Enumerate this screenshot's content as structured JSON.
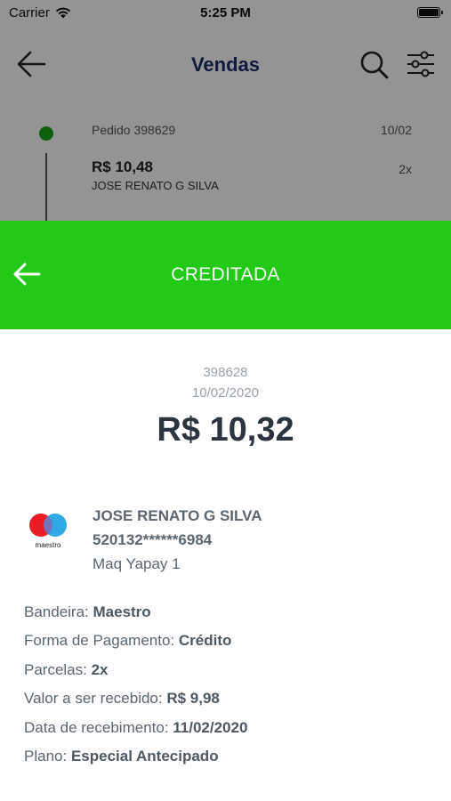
{
  "status_bar": {
    "carrier": "Carrier",
    "time": "5:25 PM"
  },
  "nav": {
    "title": "Vendas"
  },
  "order": {
    "id_label": "Pedido 398629",
    "date": "10/02",
    "amount": "R$ 10,48",
    "installments": "2x",
    "customer": "JOSE RENATO G SILVA",
    "status_color": "#18a818"
  },
  "sheet": {
    "status": "CREDITADA",
    "header_color": "#22c917",
    "transaction_id": "398628",
    "date": "10/02/2020",
    "amount": "R$ 10,32"
  },
  "card": {
    "brand_icon": "maestro-logo",
    "brand_text": "maestro",
    "holder": "JOSE RENATO G SILVA",
    "number": "520132******6984",
    "terminal": "Maq Yapay 1"
  },
  "details": [
    {
      "label": "Bandeira: ",
      "value": "Maestro"
    },
    {
      "label": "Forma de Pagamento: ",
      "value": "Crédito"
    },
    {
      "label": "Parcelas: ",
      "value": "2x"
    },
    {
      "label": "Valor a ser recebido: ",
      "value": "R$ 9,98"
    },
    {
      "label": "Data de recebimento: ",
      "value": "11/02/2020"
    },
    {
      "label": "Plano: ",
      "value": "Especial Antecipado"
    }
  ]
}
